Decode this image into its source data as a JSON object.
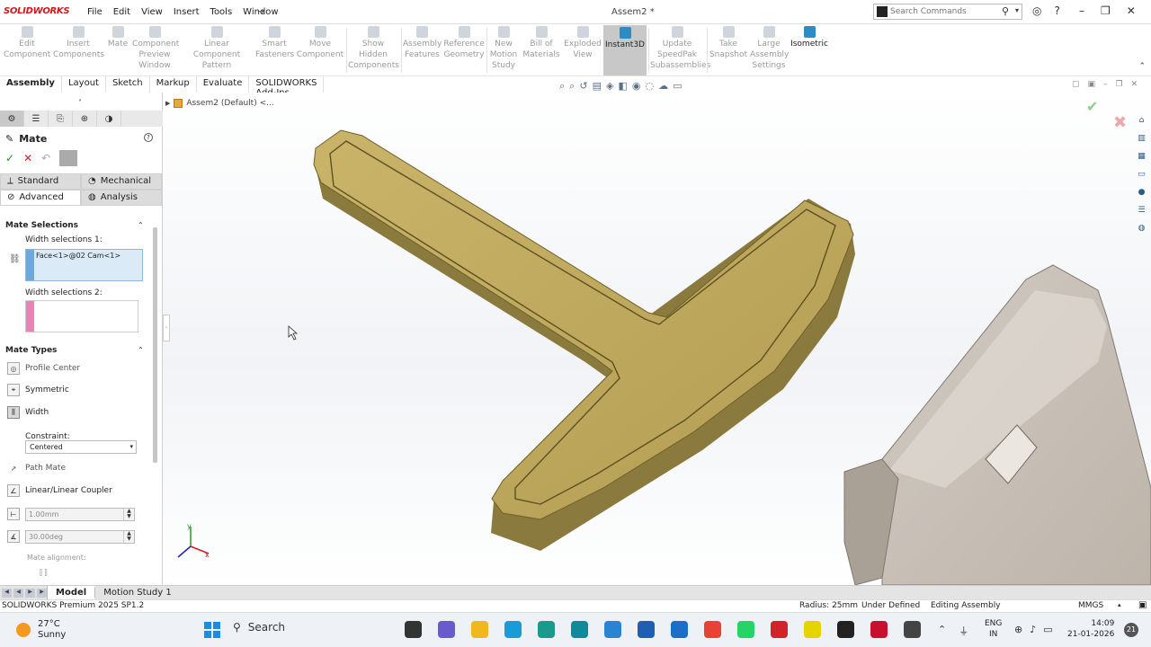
{
  "app": {
    "logo": "SOLIDWORKS",
    "menus": [
      "File",
      "Edit",
      "View",
      "Insert",
      "Tools",
      "Window"
    ],
    "doc_title": "Assem2 *",
    "search_placeholder": "Search Commands"
  },
  "ribbon": {
    "buttons": [
      {
        "label": "Edit\nComponent"
      },
      {
        "label": "Insert\nComponents"
      },
      {
        "label": "Mate"
      },
      {
        "label": "Component\nPreview\nWindow"
      },
      {
        "label": "Linear Component\nPattern"
      },
      {
        "label": "Smart\nFasteners"
      },
      {
        "label": "Move\nComponent"
      },
      {
        "label": "Show\nHidden\nComponents"
      },
      {
        "label": "Assembly\nFeatures"
      },
      {
        "label": "Reference\nGeometry"
      },
      {
        "label": "New\nMotion\nStudy"
      },
      {
        "label": "Bill of\nMaterials"
      },
      {
        "label": "Exploded\nView"
      },
      {
        "label": "Instant3D"
      },
      {
        "label": "Update\nSpeedPak\nSubassemblies"
      },
      {
        "label": "Take\nSnapshot"
      },
      {
        "label": "Large\nAssembly\nSettings"
      },
      {
        "label": "Isometric"
      }
    ]
  },
  "cmdtabs": [
    "Assembly",
    "Layout",
    "Sketch",
    "Markup",
    "Evaluate",
    "SOLIDWORKS Add-Ins"
  ],
  "tree_top": "Assem2 (Default) <...",
  "panel": {
    "title": "Mate",
    "tabs": {
      "standard": "Standard",
      "mechanical": "Mechanical",
      "advanced": "Advanced",
      "analysis": "Analysis"
    },
    "mate_selections": {
      "heading": "Mate Selections",
      "width1_label": "Width selections 1:",
      "width1_value": "Face<1>@02 Cam<1>",
      "width2_label": "Width selections 2:"
    },
    "mate_types": {
      "heading": "Mate Types",
      "items": [
        "Profile Center",
        "Symmetric",
        "Width"
      ],
      "constraint_label": "Constraint:",
      "constraint_value": "Centered",
      "path_mate": "Path Mate",
      "coupler": "Linear/Linear Coupler",
      "distance": "1.00mm",
      "angle": "30.00deg",
      "alignment": "Mate alignment:"
    }
  },
  "bottom_tabs": [
    "Model",
    "Motion Study 1"
  ],
  "status": {
    "product": "SOLIDWORKS Premium 2025 SP1.2",
    "radius": "Radius: 25mm",
    "definition": "Under Defined",
    "mode": "Editing Assembly",
    "units": "MMGS"
  },
  "taskbar": {
    "temp": "27°C",
    "weather": "Sunny",
    "search": "Search",
    "lang1": "ENG",
    "lang2": "IN",
    "time": "14:09",
    "date": "21-01-2026",
    "notifications": "21"
  }
}
